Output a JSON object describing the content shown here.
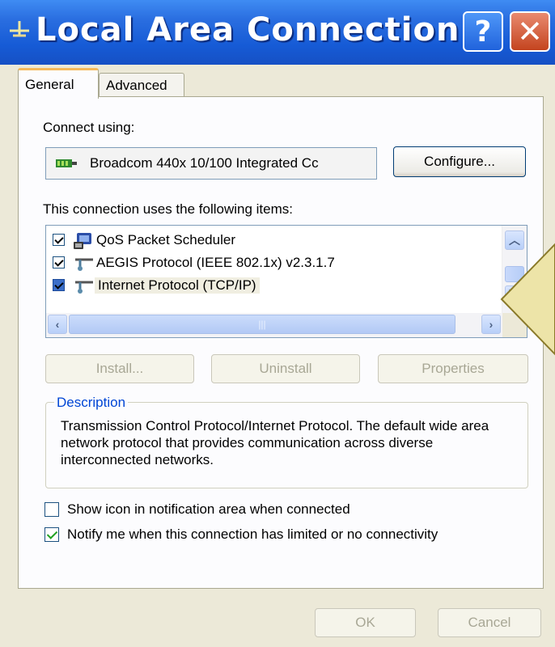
{
  "window": {
    "title": "Local Area Connection...",
    "help_label": "?",
    "close_label": "✕"
  },
  "tabs": [
    {
      "label": "General",
      "active": true
    },
    {
      "label": "Advanced",
      "active": false
    }
  ],
  "general": {
    "connect_using_label": "Connect using:",
    "adapter_name": "Broadcom 440x 10/100 Integrated Cc",
    "configure_label": "Configure...",
    "items_label": "This connection uses the following items:",
    "items": [
      {
        "label": "QoS Packet Scheduler",
        "checked": true,
        "icon": "scheduler-icon"
      },
      {
        "label": "AEGIS Protocol (IEEE 802.1x) v2.3.1.7",
        "checked": true,
        "icon": "network-protocol-icon"
      },
      {
        "label": "Internet Protocol (TCP/IP)",
        "checked": true,
        "icon": "network-protocol-icon",
        "selected": true
      }
    ],
    "install_label": "Install...",
    "uninstall_label": "Uninstall",
    "properties_label": "Properties",
    "description_title": "Description",
    "description_text": "Transmission Control Protocol/Internet Protocol. The default wide area network protocol that provides communication across diverse interconnected networks.",
    "show_icon_label": "Show icon in notification area when connected",
    "show_icon_checked": false,
    "notify_label": "Notify me when this connection has limited or no connectivity",
    "notify_checked": true
  },
  "footer": {
    "ok_label": "OK",
    "cancel_label": "Cancel"
  },
  "colors": {
    "titlebar": "#165bd6",
    "dialog_bg": "#ece9d8",
    "description_legend": "#0046d5",
    "callout_fill": "#ede4a8"
  }
}
